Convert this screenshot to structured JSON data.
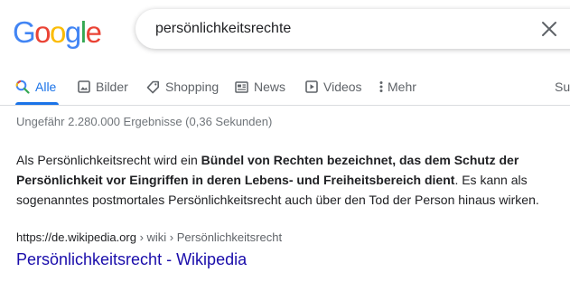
{
  "logo": {
    "letters": [
      "G",
      "o",
      "o",
      "g",
      "l",
      "e"
    ],
    "colors": [
      "#4285F4",
      "#EA4335",
      "#FBBC05",
      "#4285F4",
      "#34A853",
      "#EA4335"
    ]
  },
  "search": {
    "query": "persönlichkeitsrechte",
    "clear_icon": "close-icon"
  },
  "tabs": [
    {
      "label": "Alle",
      "icon": "search-icon",
      "active": true
    },
    {
      "label": "Bilder",
      "icon": "image-icon"
    },
    {
      "label": "Shopping",
      "icon": "tag-icon"
    },
    {
      "label": "News",
      "icon": "newspaper-icon"
    },
    {
      "label": "Videos",
      "icon": "play-icon"
    },
    {
      "label": "Mehr",
      "icon": "more-vert-icon"
    },
    {
      "label": "Suc"
    }
  ],
  "colors": {
    "accent": "#1a73e8",
    "link": "#1a0dab",
    "muted": "#70757a"
  },
  "results": {
    "stats": "Ungefähr 2.280.000 Ergebnisse (0,36 Sekunden)",
    "snippet": {
      "part1": "Als Persönlichkeitsrecht wird ein ",
      "bold": "Bündel von Rechten bezeichnet, das dem Schutz der Persönlichkeit vor Eingriffen in deren Lebens- und Freiheitsbereich dient",
      "part2": ". Es kann als sogenanntes postmortales Persönlichkeitsrecht auch über den Tod der Person hinaus wirken."
    },
    "first": {
      "url": "https://de.wikipedia.org",
      "breadcrumb": " › wiki › Persönlichkeitsrecht",
      "title": "Persönlichkeitsrecht - Wikipedia"
    }
  }
}
